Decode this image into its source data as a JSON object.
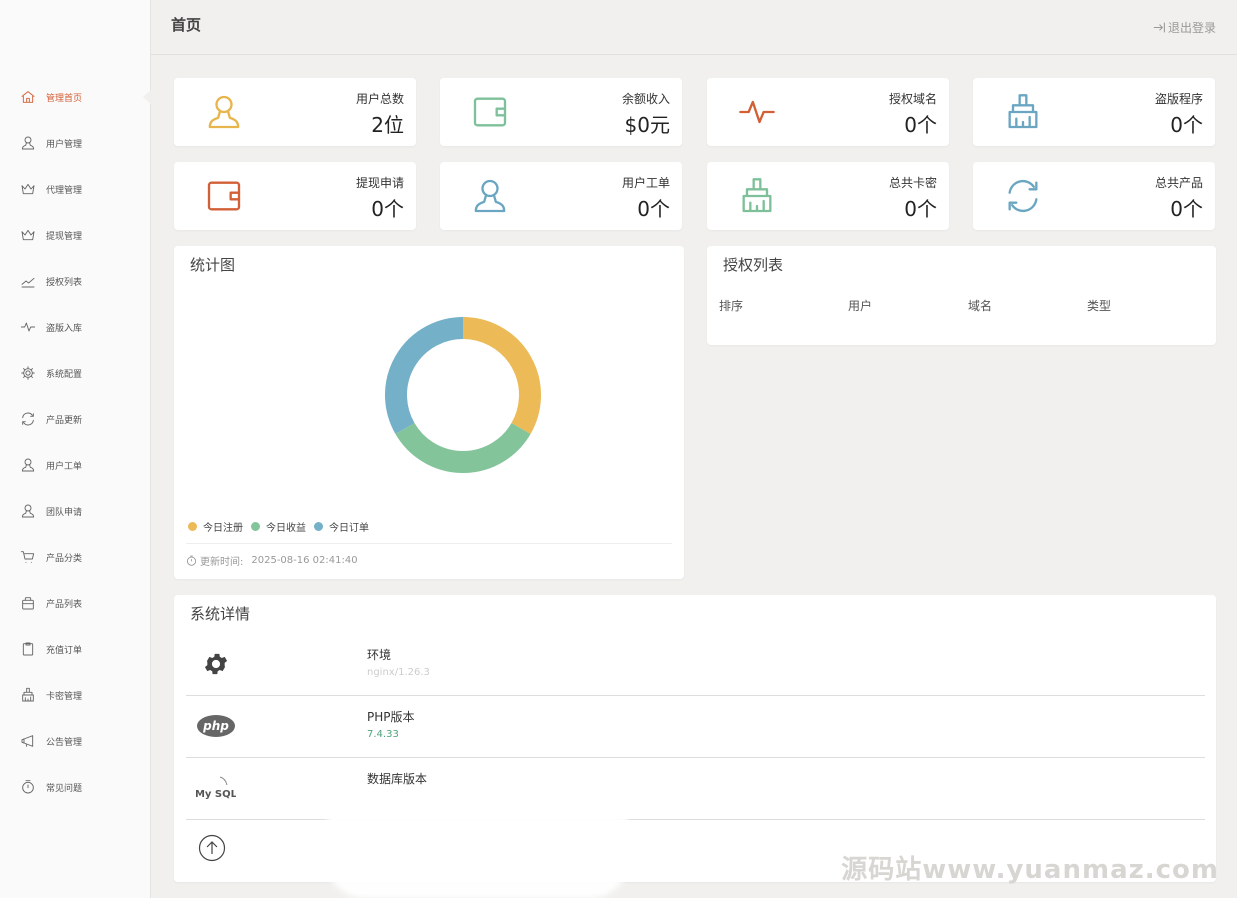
{
  "header": {
    "title": "首页",
    "logout_label": "退出登录"
  },
  "sidebar": {
    "items": [
      {
        "label": "管理首页",
        "icon": "home-icon",
        "active": true
      },
      {
        "label": "用户管理",
        "icon": "user-icon"
      },
      {
        "label": "代理管理",
        "icon": "crown-icon"
      },
      {
        "label": "提现管理",
        "icon": "crown-icon"
      },
      {
        "label": "授权列表",
        "icon": "trend-icon"
      },
      {
        "label": "盗版入库",
        "icon": "pulse-icon"
      },
      {
        "label": "系统配置",
        "icon": "gear-icon"
      },
      {
        "label": "产品更新",
        "icon": "refresh-icon"
      },
      {
        "label": "用户工单",
        "icon": "user-icon"
      },
      {
        "label": "团队申请",
        "icon": "user-icon"
      },
      {
        "label": "产品分类",
        "icon": "cart-icon"
      },
      {
        "label": "产品列表",
        "icon": "bag-icon"
      },
      {
        "label": "充值订单",
        "icon": "clipboard-icon"
      },
      {
        "label": "卡密管理",
        "icon": "brush-icon"
      },
      {
        "label": "公告管理",
        "icon": "megaphone-icon"
      },
      {
        "label": "常见问题",
        "icon": "stopwatch-icon"
      }
    ]
  },
  "stats": [
    {
      "title": "用户总数",
      "value": "2位",
      "icon": "user-icon",
      "color": "#e8b54d"
    },
    {
      "title": "余额收入",
      "value": "$0元",
      "icon": "wallet-icon",
      "color": "#7dc09a"
    },
    {
      "title": "授权域名",
      "value": "0个",
      "icon": "pulse-icon",
      "color": "#d35f36"
    },
    {
      "title": "盗版程序",
      "value": "0个",
      "icon": "brush-icon",
      "color": "#6aa6c2"
    },
    {
      "title": "提现申请",
      "value": "0个",
      "icon": "wallet-icon",
      "color": "#d35f36"
    },
    {
      "title": "用户工单",
      "value": "0个",
      "icon": "user-icon",
      "color": "#6aa6c2"
    },
    {
      "title": "总共卡密",
      "value": "0个",
      "icon": "brush-icon",
      "color": "#7dc09a"
    },
    {
      "title": "总共产品",
      "value": "0个",
      "icon": "refresh-icon",
      "color": "#6aa6c2"
    }
  ],
  "chart": {
    "title": "统计图",
    "updated_label": "更新时间:",
    "updated_time": "2025-08-16 02:41:40"
  },
  "chart_data": {
    "type": "pie",
    "donut": true,
    "series": [
      {
        "name": "今日注册",
        "value": 1,
        "color": "#ecba56"
      },
      {
        "name": "今日收益",
        "value": 1,
        "color": "#84c49b"
      },
      {
        "name": "今日订单",
        "value": 1,
        "color": "#74b0c8"
      }
    ]
  },
  "auth_list": {
    "title": "授权列表",
    "columns": [
      "排序",
      "用户",
      "域名",
      "类型"
    ]
  },
  "system": {
    "title": "系统详情",
    "rows": [
      {
        "name": "环境",
        "value": "nginx/1.26.3",
        "icon": "gear-icon",
        "value_color": "#cccccc"
      },
      {
        "name": "PHP版本",
        "value": "7.4.33",
        "icon": "php-logo-icon",
        "value_color": "#4ea47a"
      },
      {
        "name": "数据库版本",
        "value": "",
        "icon": "mysql-logo-icon",
        "value_color": "#999999"
      }
    ],
    "php_logo_text": "php",
    "mysql_logo_text": "My SQL"
  },
  "watermark": "源码站www.yuanmaz.com"
}
